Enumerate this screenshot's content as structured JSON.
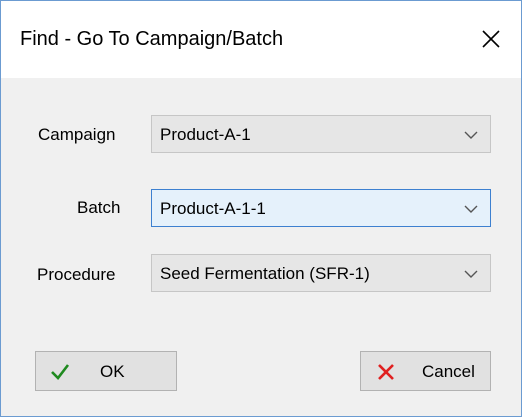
{
  "dialog": {
    "title": "Find - Go To Campaign/Batch",
    "close_icon": "close-icon"
  },
  "fields": {
    "campaign": {
      "label": "Campaign",
      "value": "Product-A-1",
      "icon": "chevron-down-icon"
    },
    "batch": {
      "label": "Batch",
      "value": "Product-A-1-1",
      "icon": "chevron-down-icon"
    },
    "procedure": {
      "label": "Procedure",
      "value": "Seed Fermentation (SFR-1)",
      "icon": "chevron-down-icon"
    }
  },
  "buttons": {
    "ok": {
      "label": "OK",
      "icon": "checkmark-icon"
    },
    "cancel": {
      "label": "Cancel",
      "icon": "cross-icon"
    }
  },
  "colors": {
    "focus_border": "#3d80d0",
    "ok_check": "#1f8a1f",
    "cancel_cross": "#e02020"
  }
}
